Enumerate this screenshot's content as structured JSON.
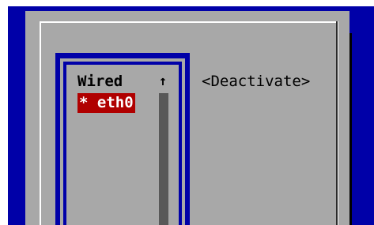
{
  "connection_list": {
    "header": "Wired",
    "scroll_indicator": "↑",
    "items": [
      {
        "label": "* eth0",
        "selected": true
      }
    ]
  },
  "actions": {
    "deactivate_label": "<Deactivate>"
  },
  "colors": {
    "screen_background": "#0000a8",
    "dialog_background": "#a8a8a8",
    "selection_background": "#b00000",
    "selection_text": "#ffffff",
    "scrollbar_track": "#585858"
  }
}
